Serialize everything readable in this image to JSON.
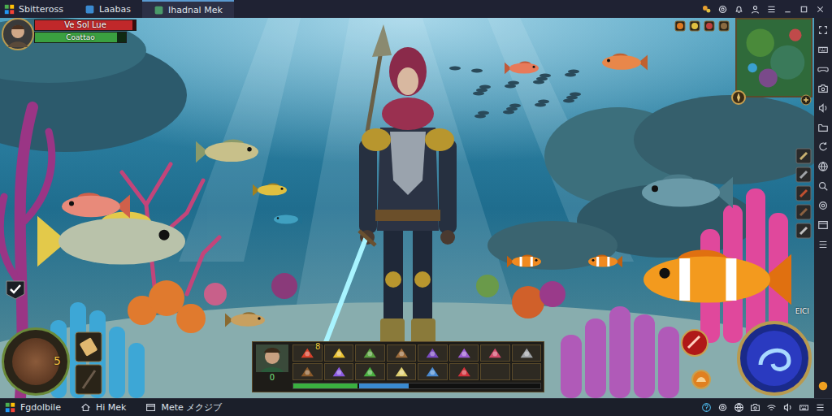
{
  "window": {
    "title": "Sbitteross"
  },
  "tabs": [
    {
      "label": "Laabas",
      "selected": false
    },
    {
      "label": "Ihadnal Mek",
      "selected": true
    }
  ],
  "player": {
    "name": "Ve Sol Lue",
    "title": "Coattao",
    "health": 0.97,
    "energy": 0.9
  },
  "quest": {
    "checked": true
  },
  "gauge": {
    "count": "5"
  },
  "hotbar": {
    "badge": "8",
    "portrait_count": "0",
    "slots": [
      {
        "kind": "item",
        "color": "#d8402a"
      },
      {
        "kind": "item",
        "color": "#e8c030"
      },
      {
        "kind": "item",
        "color": "#5aa040"
      },
      {
        "kind": "item",
        "color": "#9a6a3a"
      },
      {
        "kind": "item",
        "color": "#7a4ac0"
      },
      {
        "kind": "item",
        "color": "#9a5ad0"
      },
      {
        "kind": "item",
        "color": "#d04a6a"
      },
      {
        "kind": "item",
        "color": "#a0a4a8"
      },
      {
        "kind": "item",
        "color": "#8a5a2a"
      },
      {
        "kind": "item",
        "color": "#8a5ae0"
      },
      {
        "kind": "item",
        "color": "#4ab040"
      },
      {
        "kind": "item",
        "color": "#e0d070"
      },
      {
        "kind": "item",
        "color": "#4a8ad0"
      },
      {
        "kind": "item",
        "color": "#d0303a"
      },
      {
        "kind": "empty"
      },
      {
        "kind": "empty"
      }
    ],
    "health": 0.26,
    "mana": 0.2
  },
  "skill_orb": {
    "label": "EICI"
  },
  "taskbar": [
    {
      "label": "Fgdolbile"
    },
    {
      "label": "Hi Mek"
    },
    {
      "label": "Mete メクジブ"
    }
  ]
}
